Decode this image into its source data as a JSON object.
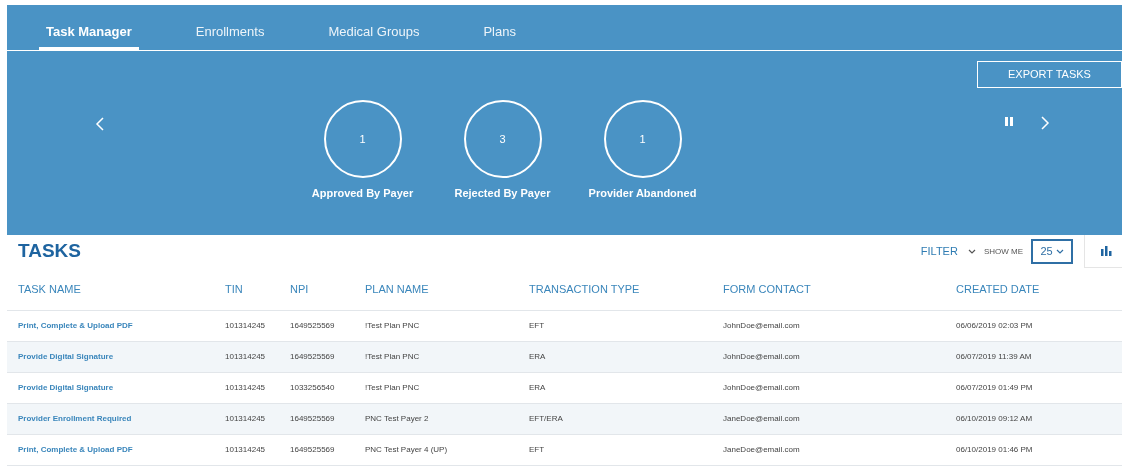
{
  "tabs": [
    {
      "label": "Task Manager",
      "selected": true
    },
    {
      "label": "Enrollments",
      "selected": false
    },
    {
      "label": "Medical Groups",
      "selected": false
    },
    {
      "label": "Plans",
      "selected": false
    }
  ],
  "export_button": "EXPORT TASKS",
  "stats": [
    {
      "count": "1",
      "label": "Approved By Payer"
    },
    {
      "count": "3",
      "label": "Rejected By Payer"
    },
    {
      "count": "1",
      "label": "Provider Abandoned"
    }
  ],
  "tasks": {
    "title": "TASKS",
    "filter": "FILTER",
    "show_me": "SHOW ME",
    "page_size": "25",
    "columns": [
      "TASK NAME",
      "TIN",
      "NPI",
      "PLAN NAME",
      "TRANSACTION TYPE",
      "FORM CONTACT",
      "CREATED DATE"
    ],
    "rows": [
      [
        "Print, Complete & Upload PDF",
        "101314245",
        "1649525569",
        "!Test Plan PNC",
        "EFT",
        "JohnDoe@email.com",
        "06/06/2019 02:03 PM"
      ],
      [
        "Provide Digital Signature",
        "101314245",
        "1649525569",
        "!Test Plan PNC",
        "ERA",
        "JohnDoe@email.com",
        "06/07/2019 11:39 AM"
      ],
      [
        "Provide Digital Signature",
        "101314245",
        "1033256540",
        "!Test Plan PNC",
        "ERA",
        "JohnDoe@email.com",
        "06/07/2019 01:49 PM"
      ],
      [
        "Provider Enrollment Required",
        "101314245",
        "1649525569",
        "PNC Test Payer 2",
        "EFT/ERA",
        "JaneDoe@email.com",
        "06/10/2019 09:12 AM"
      ],
      [
        "Print, Complete & Upload PDF",
        "101314245",
        "1649525569",
        "PNC Test Payer 4 (UP)",
        "EFT",
        "JaneDoe@email.com",
        "06/10/2019 01:46 PM"
      ]
    ]
  }
}
